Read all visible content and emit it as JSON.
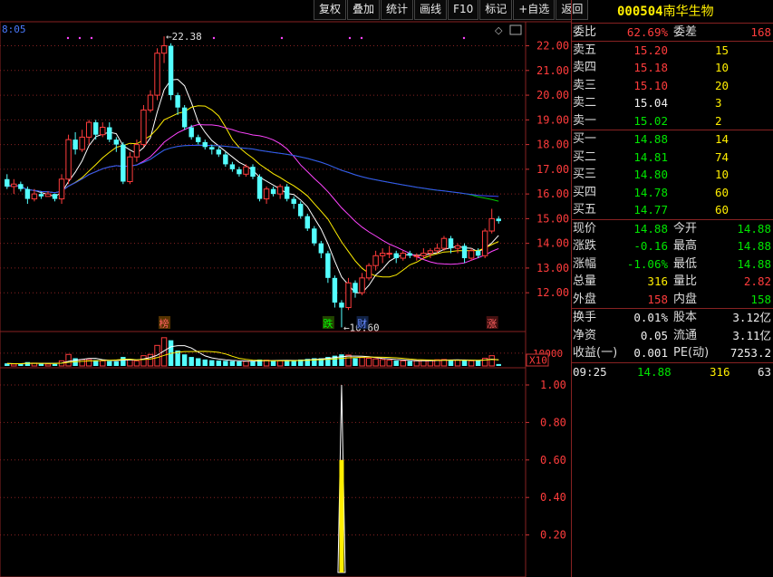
{
  "toolbar": [
    "复权",
    "叠加",
    "统计",
    "画线",
    "F10",
    "标记",
    "+自选",
    "返回"
  ],
  "stock": {
    "code": "000504",
    "name": "南华生物"
  },
  "order_book": {
    "weibi": {
      "label": "委比",
      "value": "62.69%",
      "label2": "委差",
      "value2": "168"
    },
    "asks": [
      {
        "label": "卖五",
        "price": "15.20",
        "qty": "15",
        "color": "#ff3c3c"
      },
      {
        "label": "卖四",
        "price": "15.18",
        "qty": "10",
        "color": "#ff3c3c"
      },
      {
        "label": "卖三",
        "price": "15.10",
        "qty": "20",
        "color": "#ff3c3c"
      },
      {
        "label": "卖二",
        "price": "15.04",
        "qty": "3",
        "color": "#f0f0f0"
      },
      {
        "label": "卖一",
        "price": "15.02",
        "qty": "2",
        "color": "#00e600"
      }
    ],
    "bids": [
      {
        "label": "买一",
        "price": "14.88",
        "qty": "14",
        "color": "#00e600"
      },
      {
        "label": "买二",
        "price": "14.81",
        "qty": "74",
        "color": "#00e600"
      },
      {
        "label": "买三",
        "price": "14.80",
        "qty": "10",
        "color": "#00e600"
      },
      {
        "label": "买四",
        "price": "14.78",
        "qty": "60",
        "color": "#00e600"
      },
      {
        "label": "买五",
        "price": "14.77",
        "qty": "60",
        "color": "#00e600"
      }
    ]
  },
  "quote": [
    {
      "l1": "现价",
      "v1": "14.88",
      "c1": "#00e600",
      "l2": "今开",
      "v2": "14.88",
      "c2": "#00e600"
    },
    {
      "l1": "涨跌",
      "v1": "-0.16",
      "c1": "#00e600",
      "l2": "最高",
      "v2": "14.88",
      "c2": "#00e600"
    },
    {
      "l1": "涨幅",
      "v1": "-1.06%",
      "c1": "#00e600",
      "l2": "最低",
      "v2": "14.88",
      "c2": "#00e600"
    },
    {
      "l1": "总量",
      "v1": "316",
      "c1": "#ffee00",
      "l2": "量比",
      "v2": "2.82",
      "c2": "#ff3c3c"
    },
    {
      "l1": "外盘",
      "v1": "158",
      "c1": "#ff3c3c",
      "l2": "内盘",
      "v2": "158",
      "c2": "#00e600"
    }
  ],
  "fundamentals": [
    {
      "l1": "换手",
      "v1": "0.01%",
      "l2": "股本",
      "v2": "3.12亿"
    },
    {
      "l1": "净资",
      "v1": "0.05",
      "l2": "流通",
      "v2": "3.11亿"
    },
    {
      "l1": "收益(一)",
      "v1": "0.001",
      "l2": "PE(动)",
      "v2": "7253.2"
    }
  ],
  "tick": {
    "time": "09:25",
    "price": "14.88",
    "volume": "316",
    "extra": "63"
  },
  "chart_data": {
    "type": "candlestick",
    "time_label": "8:05",
    "price_axis": {
      "ticks": [
        "22.00",
        "21.00",
        "20.00",
        "19.00",
        "18.00",
        "17.00",
        "16.00",
        "15.00",
        "14.00",
        "13.00",
        "12.00"
      ],
      "min": 11.2,
      "max": 22.9
    },
    "annotations": {
      "high": "22.38",
      "low": "10.60"
    },
    "event_labels": [
      {
        "text": "榜",
        "index": 23,
        "color": "#ff6060",
        "bg": "#553300"
      },
      {
        "text": "跌",
        "index": 47,
        "color": "#00ff00",
        "bg": "#224400"
      },
      {
        "text": "财",
        "index": 52,
        "color": "#6688ff",
        "bg": "#112244"
      },
      {
        "text": "涨",
        "index": 71,
        "color": "#ff6060",
        "bg": "#441111"
      }
    ],
    "candles": [
      [
        16.6,
        16.3,
        16.8,
        16.2
      ],
      [
        16.3,
        16.4,
        16.6,
        16.0
      ],
      [
        16.4,
        16.2,
        16.5,
        16.1
      ],
      [
        16.2,
        15.8,
        16.3,
        15.6
      ],
      [
        15.8,
        16.0,
        16.2,
        15.7
      ],
      [
        16.0,
        15.9,
        16.1,
        15.8
      ],
      [
        15.9,
        16.0,
        16.1,
        15.9
      ],
      [
        16.0,
        15.8,
        16.0,
        15.7
      ],
      [
        15.8,
        16.6,
        16.8,
        15.6
      ],
      [
        16.6,
        18.2,
        18.4,
        16.4
      ],
      [
        18.2,
        17.8,
        18.5,
        17.6
      ],
      [
        17.8,
        18.3,
        18.6,
        17.7
      ],
      [
        18.3,
        18.9,
        19.0,
        18.0
      ],
      [
        18.9,
        18.4,
        19.0,
        18.2
      ],
      [
        18.4,
        18.7,
        18.9,
        18.3
      ],
      [
        18.7,
        18.2,
        18.9,
        18.1
      ],
      [
        18.2,
        18.0,
        18.3,
        17.7
      ],
      [
        18.0,
        16.5,
        18.1,
        16.4
      ],
      [
        16.5,
        17.5,
        17.7,
        16.4
      ],
      [
        17.5,
        18.0,
        18.2,
        17.3
      ],
      [
        18.0,
        19.4,
        19.6,
        17.9
      ],
      [
        19.4,
        20.0,
        20.2,
        19.3
      ],
      [
        20.0,
        21.7,
        21.9,
        19.8
      ],
      [
        21.7,
        22.0,
        22.38,
        21.3
      ],
      [
        22.0,
        20.0,
        22.1,
        19.8
      ],
      [
        20.0,
        19.5,
        20.1,
        19.2
      ],
      [
        19.5,
        18.7,
        19.6,
        18.6
      ],
      [
        18.7,
        18.3,
        18.8,
        18.2
      ],
      [
        18.3,
        18.1,
        18.4,
        18.0
      ],
      [
        18.1,
        17.9,
        18.2,
        17.8
      ],
      [
        17.9,
        17.8,
        18.0,
        17.6
      ],
      [
        17.8,
        17.6,
        17.9,
        17.5
      ],
      [
        17.6,
        17.2,
        17.7,
        17.1
      ],
      [
        17.2,
        17.0,
        17.3,
        16.9
      ],
      [
        17.0,
        16.8,
        17.1,
        16.7
      ],
      [
        16.8,
        17.1,
        17.2,
        16.7
      ],
      [
        17.1,
        16.7,
        17.2,
        16.6
      ],
      [
        16.7,
        15.8,
        16.8,
        15.7
      ],
      [
        15.8,
        16.2,
        16.3,
        15.6
      ],
      [
        16.2,
        16.0,
        16.3,
        15.9
      ],
      [
        16.0,
        16.3,
        16.4,
        15.8
      ],
      [
        16.3,
        15.8,
        16.4,
        15.7
      ],
      [
        15.8,
        15.6,
        15.9,
        15.4
      ],
      [
        15.6,
        15.1,
        15.7,
        15.0
      ],
      [
        15.1,
        14.6,
        15.2,
        14.5
      ],
      [
        14.6,
        14.0,
        14.7,
        13.9
      ],
      [
        14.0,
        13.6,
        14.1,
        13.4
      ],
      [
        13.6,
        12.6,
        13.7,
        12.4
      ],
      [
        12.6,
        11.6,
        12.7,
        11.4
      ],
      [
        11.6,
        11.4,
        11.7,
        10.6
      ],
      [
        11.4,
        12.4,
        12.6,
        11.3
      ],
      [
        12.4,
        12.0,
        12.5,
        11.8
      ],
      [
        12.0,
        12.6,
        12.8,
        11.9
      ],
      [
        12.6,
        13.1,
        13.2,
        12.5
      ],
      [
        13.1,
        13.5,
        13.7,
        12.9
      ],
      [
        13.5,
        13.6,
        13.8,
        13.2
      ],
      [
        13.6,
        13.6,
        13.9,
        13.4
      ],
      [
        13.6,
        13.4,
        13.7,
        13.2
      ],
      [
        13.4,
        13.6,
        13.7,
        13.3
      ],
      [
        13.6,
        13.5,
        13.7,
        13.4
      ],
      [
        13.5,
        13.5,
        13.6,
        13.3
      ],
      [
        13.5,
        13.6,
        13.8,
        13.4
      ],
      [
        13.6,
        13.7,
        13.8,
        13.4
      ],
      [
        13.7,
        13.8,
        14.0,
        13.6
      ],
      [
        13.8,
        14.2,
        14.3,
        13.7
      ],
      [
        14.2,
        13.8,
        14.3,
        13.6
      ],
      [
        13.8,
        13.9,
        14.0,
        13.6
      ],
      [
        13.9,
        13.4,
        14.0,
        13.2
      ],
      [
        13.4,
        13.7,
        13.8,
        13.3
      ],
      [
        13.7,
        13.5,
        13.8,
        13.4
      ],
      [
        13.5,
        14.5,
        14.6,
        13.4
      ],
      [
        14.5,
        15.0,
        15.4,
        14.4
      ],
      [
        15.0,
        14.9,
        15.1,
        14.8
      ]
    ],
    "volumes": [
      200,
      150,
      180,
      300,
      220,
      180,
      150,
      160,
      400,
      900,
      600,
      500,
      500,
      450,
      400,
      380,
      350,
      700,
      500,
      400,
      800,
      900,
      1600,
      2200,
      2000,
      1200,
      900,
      700,
      600,
      500,
      450,
      420,
      400,
      380,
      350,
      360,
      380,
      500,
      450,
      420,
      400,
      420,
      450,
      500,
      550,
      600,
      600,
      700,
      800,
      900,
      850,
      600,
      650,
      600,
      550,
      500,
      450,
      420,
      400,
      380,
      400,
      420,
      450,
      480,
      500,
      480,
      450,
      420,
      400,
      420,
      600,
      800,
      150
    ],
    "volume_axis": {
      "label": "10000",
      "unit": "X10",
      "max": 2400
    },
    "indicator": {
      "ticks": [
        "1.00",
        "0.80",
        "0.60",
        "0.40",
        "0.20"
      ],
      "spike_index": 49,
      "spike_value": 1.0
    }
  }
}
